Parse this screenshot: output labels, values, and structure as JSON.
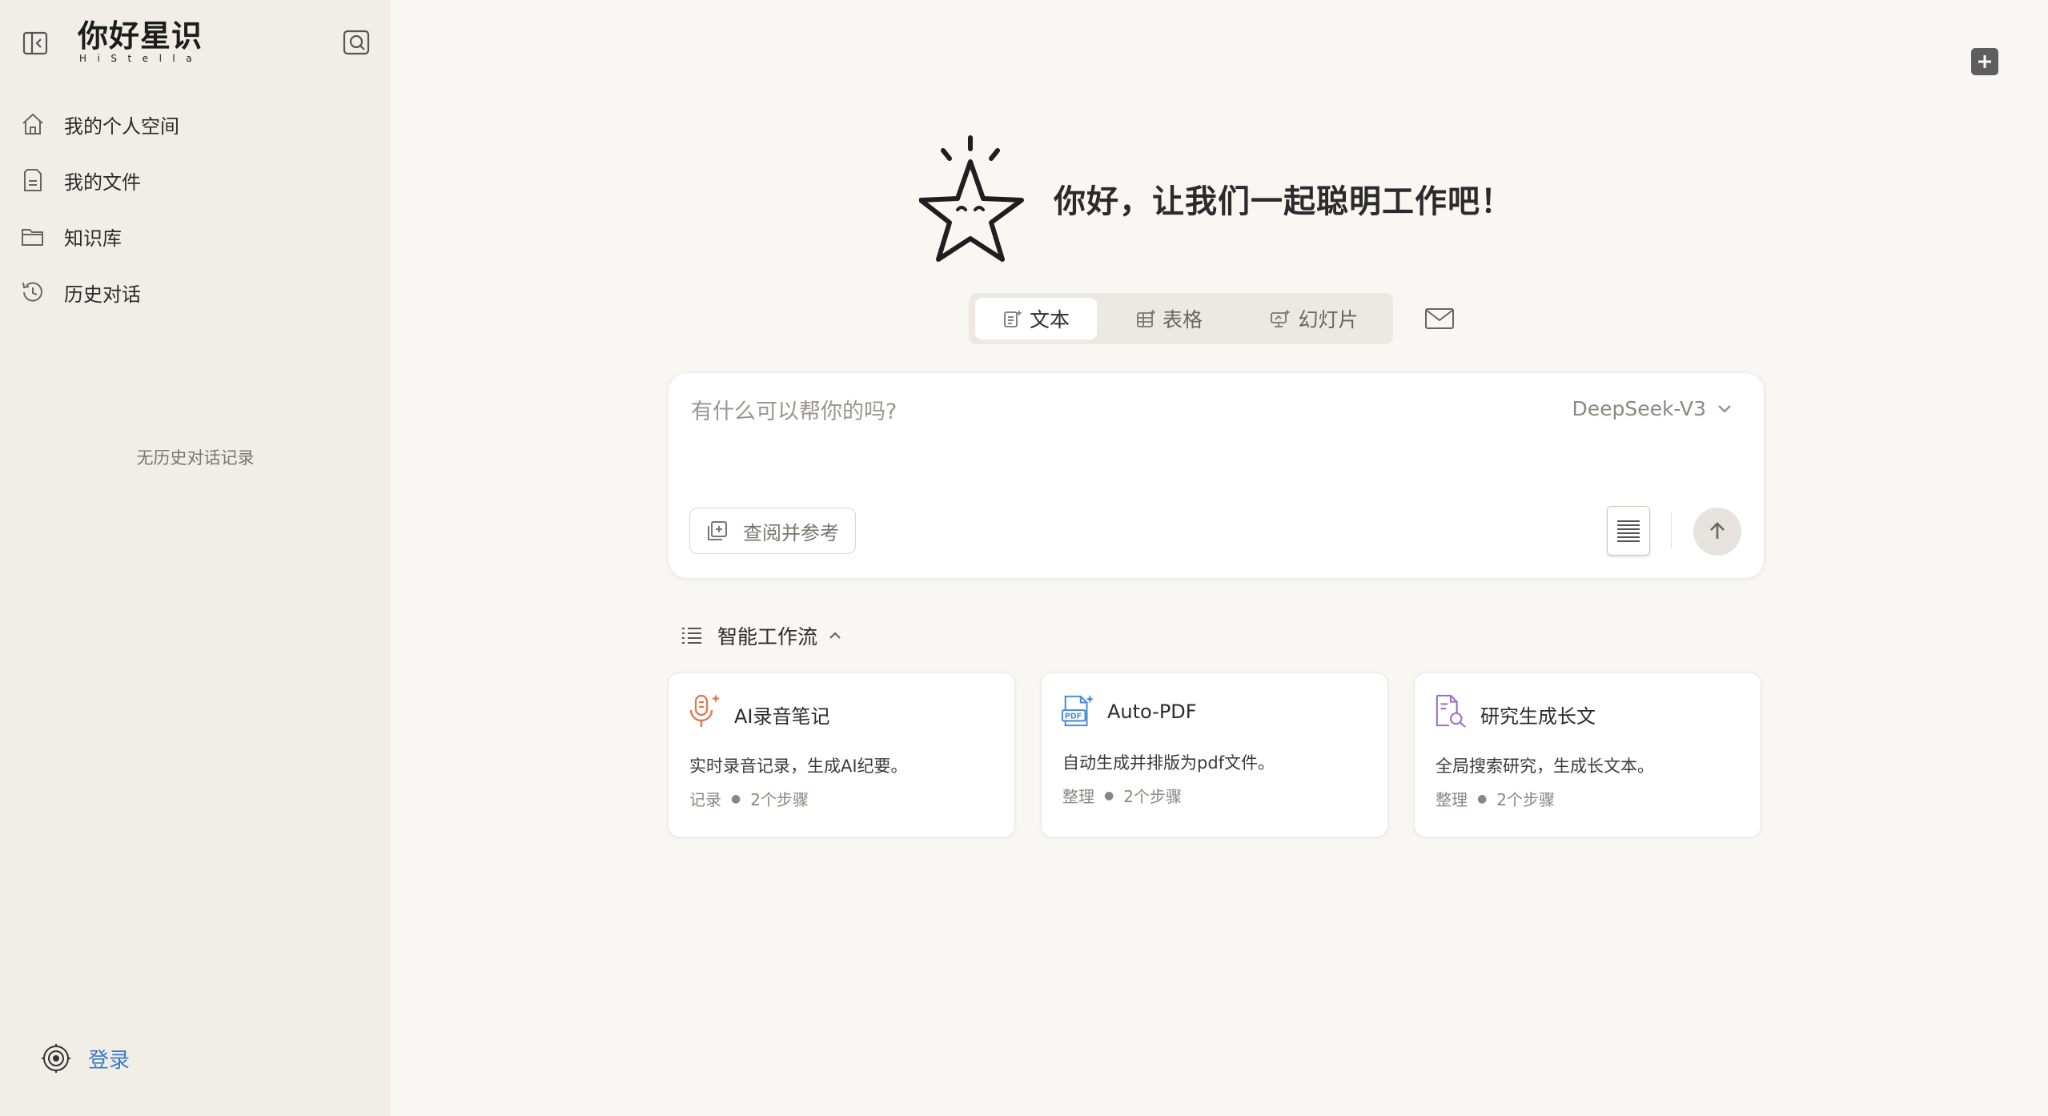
{
  "app": {
    "title": "你好星识",
    "subtitle": "HiStella"
  },
  "sidebar": {
    "items": [
      {
        "label": "我的个人空间",
        "icon": "home-icon"
      },
      {
        "label": "我的文件",
        "icon": "file-icon"
      },
      {
        "label": "知识库",
        "icon": "folder-icon"
      },
      {
        "label": "历史对话",
        "icon": "history-icon"
      }
    ],
    "empty_history": "无历史对话记录",
    "login_label": "登录"
  },
  "main": {
    "greeting": "你好，让我们一起聪明工作吧！",
    "tabs": [
      {
        "label": "文本",
        "icon": "text-doc-icon",
        "active": true
      },
      {
        "label": "表格",
        "icon": "table-icon",
        "active": false
      },
      {
        "label": "幻灯片",
        "icon": "slides-icon",
        "active": false
      }
    ],
    "composer": {
      "placeholder": "有什么可以帮你的吗?",
      "model": "DeepSeek-V3",
      "reference_button": "查阅并参考"
    },
    "workflow": {
      "header": "智能工作流",
      "cards": [
        {
          "title": "AI录音笔记",
          "desc": "实时录音记录，生成AI纪要。",
          "category": "记录",
          "steps": "2个步骤",
          "icon": "microphone-icon"
        },
        {
          "title": "Auto-PDF",
          "desc": "自动生成并排版为pdf文件。",
          "category": "整理",
          "steps": "2个步骤",
          "icon": "pdf-icon"
        },
        {
          "title": "研究生成长文",
          "desc": "全局搜索研究，生成长文本。",
          "category": "整理",
          "steps": "2个步骤",
          "icon": "doc-search-icon"
        }
      ]
    }
  },
  "colors": {
    "sidebar_bg": "#f1eee8",
    "main_bg": "#f9f7f3",
    "link_blue": "#3a78c9",
    "mic_orange": "#e07a4f",
    "pdf_blue": "#4a8ed8",
    "research_purple": "#9b6fd1"
  }
}
